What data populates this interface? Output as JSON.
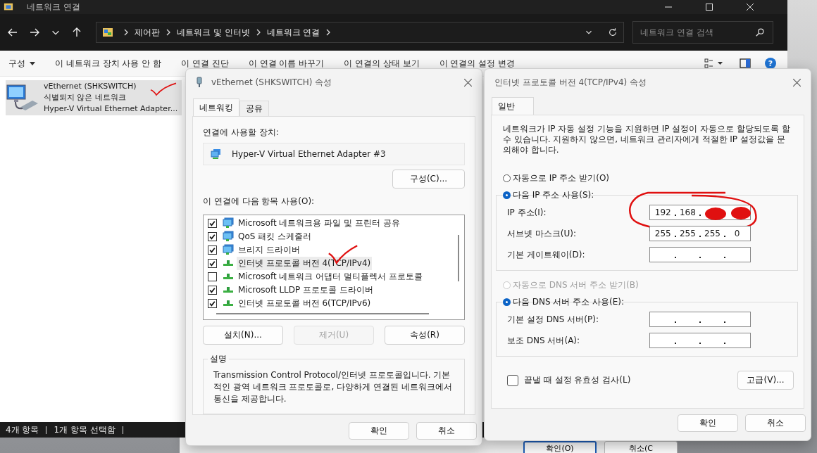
{
  "explorer": {
    "title": "네트워크 연결",
    "breadcrumb": [
      "제어판",
      "네트워크 및 인터넷",
      "네트워크 연결"
    ],
    "search": {
      "placeholder": "네트워크 연결 검색"
    },
    "commands": [
      {
        "label": "구성",
        "dropdown": true
      },
      {
        "label": "이 네트워크 장치 사용 안 함",
        "dropdown": false
      },
      {
        "label": "이 연결 진단",
        "dropdown": false
      },
      {
        "label": "이 연결 이름 바꾸기",
        "dropdown": false
      },
      {
        "label": "이 연결의 상태 보기",
        "dropdown": false
      },
      {
        "label": "이 연결의 설정 변경",
        "dropdown": false
      }
    ],
    "help_glyph": "?",
    "items": [
      {
        "name": "vEthernet (SHKSWITCH)",
        "status": "식별되지 않은 네트워크",
        "device": "Hyper-V Virtual Ethernet Adapter...",
        "selected": true
      }
    ],
    "status_bar": [
      "4개 항목",
      "1개 항목 선택함"
    ]
  },
  "properties_dialog": {
    "title": "vEthernet (SHKSWITCH) 속성",
    "tabs": [
      {
        "label": "네트워킹",
        "selected": true
      },
      {
        "label": "공유",
        "selected": false
      }
    ],
    "device_label": "연결에 사용할 장치:",
    "device": "Hyper-V Virtual Ethernet Adapter #3",
    "configure_button": "구성(C)...",
    "items_label": "이 연결에 다음 항목 사용(O):",
    "items": [
      {
        "label": "Microsoft 네트워크용 파일 및 프린터 공유",
        "kind": "service",
        "checked": true,
        "selected": false
      },
      {
        "label": "QoS 패킷 스케줄러",
        "kind": "service",
        "checked": true,
        "selected": false
      },
      {
        "label": "브리지 드라이버",
        "kind": "service",
        "checked": true,
        "selected": false
      },
      {
        "label": "인터넷 프로토콜 버전 4(TCP/IPv4)",
        "kind": "protocol",
        "checked": true,
        "selected": true
      },
      {
        "label": "Microsoft 네트워크 어댑터 멀티플렉서 프로토콜",
        "kind": "protocol",
        "checked": false,
        "selected": false
      },
      {
        "label": "Microsoft LLDP 프로토콜 드라이버",
        "kind": "protocol",
        "checked": true,
        "selected": false
      },
      {
        "label": "인터넷 프로토콜 버전 6(TCP/IPv6)",
        "kind": "protocol",
        "checked": true,
        "selected": false
      }
    ],
    "item_buttons": [
      {
        "label": "설치(N)...",
        "disabled": false
      },
      {
        "label": "제거(U)",
        "disabled": true
      },
      {
        "label": "속성(R)",
        "disabled": false
      }
    ],
    "description": {
      "title": "설명",
      "text": "Transmission Control Protocol/인터넷 프로토콜입니다. 기본적인 광역 네트워크 프로토콜로, 다양하게 연결된 네트워크에서 통신을 제공합니다."
    },
    "buttons": [
      "확인",
      "취소"
    ]
  },
  "ipv4_dialog": {
    "title": "인터넷 프로토콜 버전 4(TCP/IPv4) 속성",
    "tabs": [
      {
        "label": "일반",
        "selected": true
      }
    ],
    "intro": "네트워크가 IP 자동 설정 기능을 지원하면 IP 설정이 자동으로 할당되도록 할 수 있습니다. 지원하지 않으면, 네트워크 관리자에게 적절한 IP 설정값을 문의해야 합니다.",
    "ip_modes": [
      {
        "label": "자동으로 IP 주소 받기(O)",
        "selected": false,
        "disabled": false
      },
      {
        "label": "다음 IP 주소 사용(S):",
        "selected": true,
        "disabled": false
      }
    ],
    "ip_fields": [
      {
        "label": "IP 주소(I):",
        "octets": [
          "192",
          "168"
        ],
        "redacted": true
      },
      {
        "label": "서브넷 마스크(U):",
        "octets": [
          "255",
          "255",
          "255",
          "0"
        ],
        "redacted": false
      },
      {
        "label": "기본 게이트웨이(D):",
        "redacted": false
      }
    ],
    "dns_modes": [
      {
        "label": "자동으로 DNS 서버 주소 받기(B)",
        "selected": false,
        "disabled": true
      },
      {
        "label": "다음 DNS 서버 주소 사용(E):",
        "selected": true,
        "disabled": false
      }
    ],
    "dns_fields": [
      {
        "label": "기본 설정 DNS 서버(P):",
        "redacted": false
      },
      {
        "label": "보조 DNS 서버(A):",
        "redacted": false
      }
    ],
    "validate": {
      "label": "끝낼 때 설정 유효성 검사(L)",
      "checked": false
    },
    "advanced_button": "고급(V)...",
    "buttons": [
      "확인",
      "취소"
    ]
  },
  "background_window": {
    "buttons": [
      "확인(O)",
      "취소(C"
    ]
  }
}
